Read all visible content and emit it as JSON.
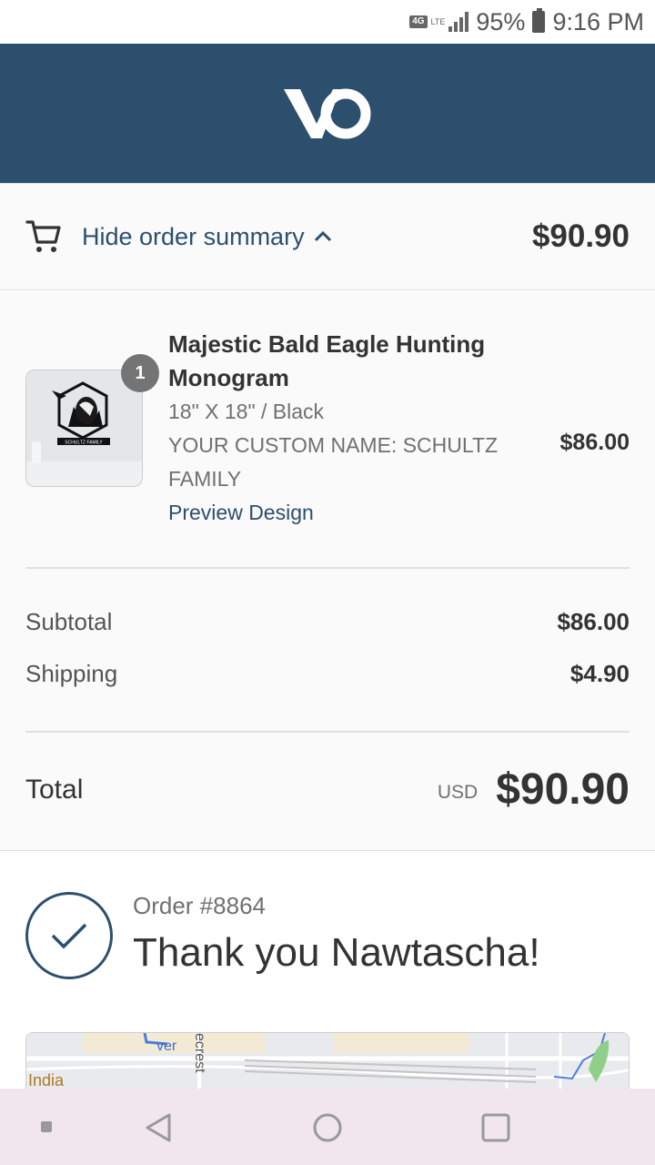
{
  "status_bar": {
    "network": "4G",
    "lte": "LTE",
    "battery": "95%",
    "time": "9:16 PM"
  },
  "header": {
    "logo_text": "VO",
    "brand_color": "#2c4f6e"
  },
  "summary_toggle": {
    "label": "Hide order summary",
    "total": "$90.90",
    "icon": "cart-icon"
  },
  "product": {
    "quantity": "1",
    "name": "Majestic Bald Eagle Hunting Monogram",
    "variant": "18\" X 18\" / Black",
    "custom": "YOUR CUSTOM NAME: SCHULTZ FAMILY",
    "preview_link": "Preview Design",
    "price": "$86.00"
  },
  "costs": {
    "subtotal_label": "Subtotal",
    "subtotal_value": "$86.00",
    "shipping_label": "Shipping",
    "shipping_value": "$4.90"
  },
  "total": {
    "label": "Total",
    "currency": "USD",
    "value": "$90.90"
  },
  "confirmation": {
    "order_number": "Order #8864",
    "message": "Thank you Nawtascha!"
  },
  "map": {
    "labels": [
      "ver",
      "ecrest",
      "India"
    ]
  },
  "nav_bar": {
    "icons": [
      "recents-dot-icon",
      "back-icon",
      "home-icon",
      "overview-icon"
    ]
  }
}
